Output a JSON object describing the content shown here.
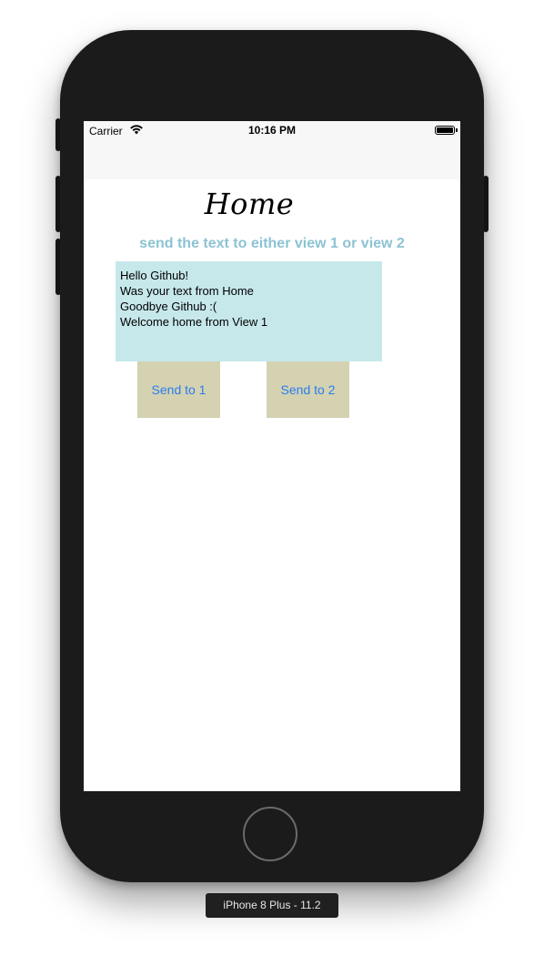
{
  "status_bar": {
    "carrier": "Carrier",
    "time": "10:16 PM",
    "icons": [
      "wifi-icon",
      "battery-icon"
    ]
  },
  "screen": {
    "title": "Home",
    "subtitle": "send the text to either view 1 or view 2",
    "textview_lines": [
      "Hello Github!",
      "Was your text from Home",
      "Goodbye Github :(",
      "Welcome home from View 1"
    ],
    "buttons": {
      "send1": "Send to 1",
      "send2": "Send to 2"
    }
  },
  "simulator": {
    "device_label": "iPhone 8 Plus - 11.2"
  },
  "colors": {
    "subtitle": "#8cc3d3",
    "textview_bg": "#c7e8eb",
    "button_bg": "#d4d2b1",
    "button_text": "#2a7cf0",
    "device_body": "#1b1b1b"
  }
}
